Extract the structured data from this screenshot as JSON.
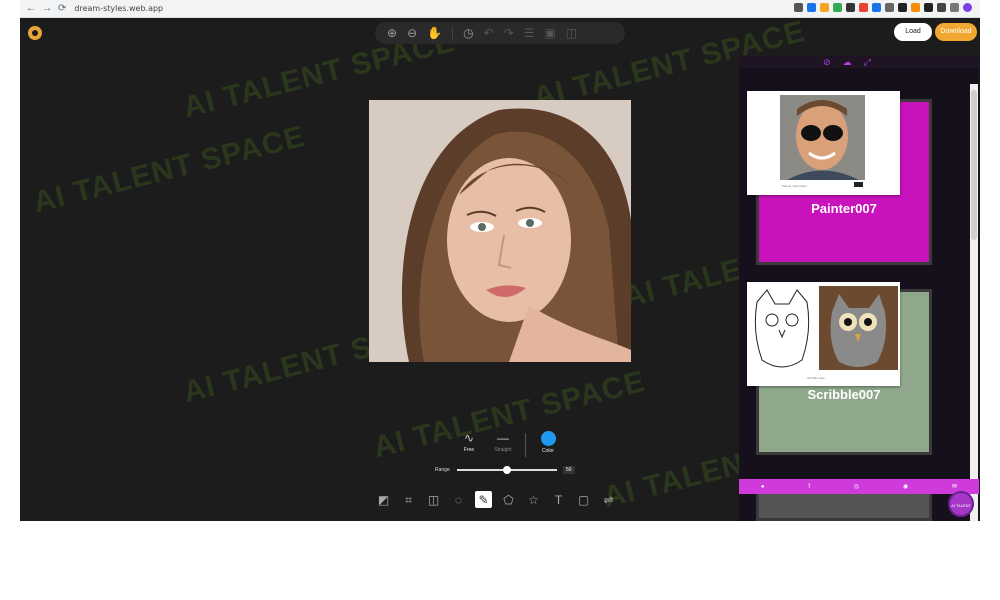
{
  "browser": {
    "url": "dream-styles.web.app",
    "nav": {
      "back": "←",
      "forward": "→",
      "reload": "⟳"
    }
  },
  "watermark": {
    "text": "AI TALENT SPACE",
    "color": "#7ec828"
  },
  "app": {
    "header": {
      "load_label": "Load",
      "download_label": "Download",
      "download_color": "#f0a830"
    },
    "top_tools": [
      "zoom-in-icon",
      "zoom-out-icon",
      "hand-icon",
      "history-icon",
      "undo-icon",
      "redo-icon",
      "layers-icon",
      "compare-icon",
      "split-icon"
    ],
    "brush": {
      "free_label": "Free",
      "straight_label": "Straight",
      "color_label": "Color",
      "color_value": "#1e9bf0",
      "range_label": "Range",
      "range_value": "50",
      "range_fraction": 0.5
    },
    "bottom_tools": [
      "filter-icon",
      "crop-icon",
      "flip-icon",
      "rotate-icon",
      "draw-icon",
      "shape-icon",
      "sticker-icon",
      "text-icon",
      "frame-icon",
      "adjust-icon"
    ],
    "panel": {
      "cards": [
        {
          "title": "Painter007",
          "bg": "#c812bc",
          "caption": "Painter style photo"
        },
        {
          "title": "Scribble007",
          "bg": "#8fa88c",
          "caption": "Scribble style"
        }
      ]
    },
    "fab_label": "AI TALENT"
  }
}
